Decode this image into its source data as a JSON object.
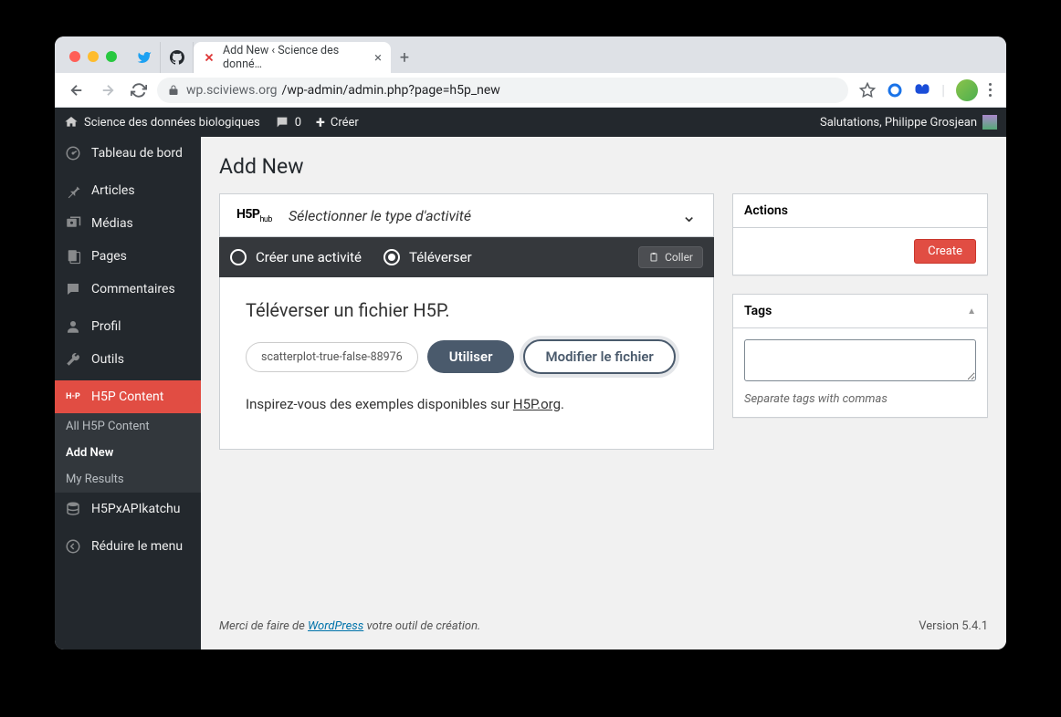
{
  "browser": {
    "pinned_tabs": [
      "twitter",
      "github"
    ],
    "tab_title": "Add New ‹ Science des donné…",
    "url_host": "wp.sciviews.org",
    "url_path": "/wp-admin/admin.php?page=h5p_new"
  },
  "adminbar": {
    "site_name": "Science des données biologiques",
    "comment_count": "0",
    "new_label": "Créer",
    "greeting": "Salutations, Philippe Grosjean"
  },
  "sidebar": {
    "items": [
      {
        "label": "Tableau de bord",
        "icon": "dashboard"
      },
      {
        "label": "Articles",
        "icon": "pin"
      },
      {
        "label": "Médias",
        "icon": "media"
      },
      {
        "label": "Pages",
        "icon": "pages"
      },
      {
        "label": "Commentaires",
        "icon": "comment"
      },
      {
        "label": "Profil",
        "icon": "user"
      },
      {
        "label": "Outils",
        "icon": "tools"
      },
      {
        "label": "H5P Content",
        "icon": "h5p"
      },
      {
        "label": "H5PxAPIkatchu",
        "icon": "database"
      },
      {
        "label": "Réduire le menu",
        "icon": "collapse"
      }
    ],
    "submenu": [
      {
        "label": "All H5P Content"
      },
      {
        "label": "Add New"
      },
      {
        "label": "My Results"
      }
    ]
  },
  "page": {
    "title": "Add New"
  },
  "h5p": {
    "hub_label": "Sélectionner le type d'activité",
    "tab_create": "Créer une activité",
    "tab_upload": "Téléverser",
    "paste_btn": "Coller",
    "upload_heading": "Téléverser un fichier H5P.",
    "file_name": "scatterplot-true-false-88976",
    "use_btn": "Utiliser",
    "modify_btn": "Modifier le fichier",
    "inspire_prefix": "Inspirez-vous des exemples disponibles sur ",
    "inspire_link": "H5P.org",
    "inspire_suffix": "."
  },
  "actions": {
    "heading": "Actions",
    "create_btn": "Create"
  },
  "tags": {
    "heading": "Tags",
    "hint": "Separate tags with commas"
  },
  "footer": {
    "thanks_prefix": "Merci de faire de ",
    "wp_link": "WordPress",
    "thanks_suffix": " votre outil de création.",
    "version": "Version 5.4.1"
  }
}
